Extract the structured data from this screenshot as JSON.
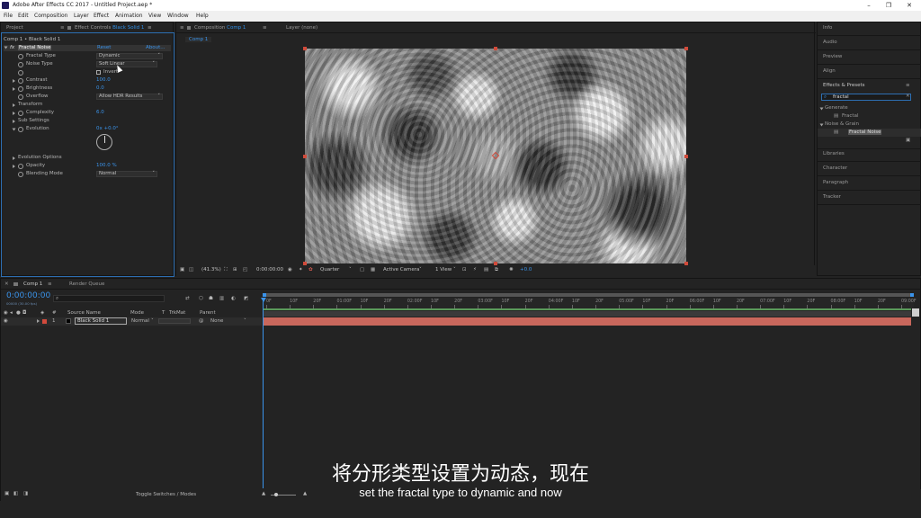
{
  "window": {
    "title": "Adobe After Effects CC 2017 - Untitled Project.aep *",
    "minimize": "–",
    "restore": "❐",
    "close": "✕"
  },
  "menu": [
    "File",
    "Edit",
    "Composition",
    "Layer",
    "Effect",
    "Animation",
    "View",
    "Window",
    "Help"
  ],
  "project_panel": {
    "tab": "Project"
  },
  "effect_controls": {
    "tab_prefix": "Effect Controls",
    "tab_layer": "Black Solid 1",
    "breadcrumb": "Comp 1 • Black Solid 1",
    "effect_name": "Fractal Noise",
    "fx_badge": "fx",
    "reset_label": "Reset",
    "about_label": "About...",
    "properties": [
      {
        "label": "Fractal Type",
        "type": "dropdown",
        "value": "Dynamic"
      },
      {
        "label": "Noise Type",
        "type": "dropdown",
        "value": "Soft Linear"
      },
      {
        "label": "",
        "type": "checkbox",
        "value": "Invert"
      },
      {
        "label": "Contrast",
        "type": "number",
        "value": "100.0"
      },
      {
        "label": "Brightness",
        "type": "number",
        "value": "0.0"
      },
      {
        "label": "Overflow",
        "type": "dropdown",
        "value": "Allow HDR Results"
      },
      {
        "label": "Transform",
        "type": "group",
        "value": ""
      },
      {
        "label": "Complexity",
        "type": "number",
        "value": "6.0"
      },
      {
        "label": "Sub Settings",
        "type": "group",
        "value": ""
      },
      {
        "label": "Evolution",
        "type": "number",
        "value": "0x +0.0°"
      },
      {
        "label": "Evolution Options",
        "type": "group",
        "value": ""
      },
      {
        "label": "Opacity",
        "type": "number",
        "value": "100.0 %"
      },
      {
        "label": "Blending Mode",
        "type": "dropdown",
        "value": "Normal"
      }
    ]
  },
  "composition_panel": {
    "tab_prefix": "Composition",
    "tab_comp": "Comp 1",
    "layer_tab": "Layer (none)",
    "subtab": "Comp 1",
    "toolbar": {
      "zoom": "(41.3%)",
      "timecode": "0:00:00:00",
      "resolution": "Quarter",
      "camera": "Active Camera",
      "views": "1 View",
      "exposure": "+0.0"
    }
  },
  "right_panels": {
    "top": [
      "Info",
      "Audio",
      "Preview",
      "Align"
    ],
    "effects_presets": {
      "title": "Effects & Presets",
      "search_value": "fractal",
      "groups": [
        {
          "name": "Generate",
          "items": [
            "Fractal"
          ]
        },
        {
          "name": "Noise & Grain",
          "items": [
            "Fractal Noise"
          ]
        }
      ]
    },
    "bottom": [
      "Libraries",
      "Character",
      "Paragraph",
      "Tracker"
    ]
  },
  "timeline": {
    "tab": "Comp 1",
    "render_queue_tab": "Render Queue",
    "timecode": "0:00:00:00",
    "timecode_sub": "00000 (30.00 fps)",
    "search_placeholder": "",
    "columns": {
      "hash": "#",
      "source_name": "Source Name",
      "mode": "Mode",
      "t": "T",
      "trkmat": "TrkMat",
      "parent": "Parent"
    },
    "layers": [
      {
        "index": "1",
        "name": "Black Solid 1",
        "mode": "Normal",
        "parent": "None"
      }
    ],
    "ruler": [
      "0F",
      "10F",
      "20F",
      "01:00F",
      "10F",
      "20F",
      "02:00F",
      "10F",
      "20F",
      "03:00F",
      "10F",
      "20F",
      "04:00F",
      "10F",
      "20F",
      "05:00F",
      "10F",
      "20F",
      "06:00F",
      "10F",
      "20F",
      "07:00F",
      "10F",
      "20F",
      "08:00F",
      "10F",
      "20F",
      "09:00F"
    ],
    "footer": "Toggle Switches / Modes"
  },
  "subtitles": {
    "chinese": "将分形类型设置为动态，现在",
    "english": "set the fractal type to dynamic and now"
  },
  "colors": {
    "accent_blue": "#2e8ee6",
    "layer_bar": "#c8675c",
    "work_area_green": "#5a9a5a",
    "layer_label": "#d24a3c"
  }
}
